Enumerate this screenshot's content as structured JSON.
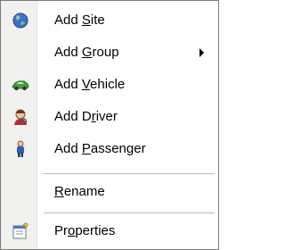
{
  "menu": {
    "items": [
      {
        "pre": "Add ",
        "ul": "S",
        "post": "ite",
        "icon": "globe-icon",
        "submenu": false
      },
      {
        "pre": "Add ",
        "ul": "G",
        "post": "roup",
        "icon": "",
        "submenu": true
      },
      {
        "pre": "Add ",
        "ul": "V",
        "post": "ehicle",
        "icon": "car-icon",
        "submenu": false
      },
      {
        "pre": "Add D",
        "ul": "r",
        "post": "iver",
        "icon": "driver-icon",
        "submenu": false
      },
      {
        "pre": "Add ",
        "ul": "P",
        "post": "assenger",
        "icon": "passenger-icon",
        "submenu": false
      },
      {
        "pre": "",
        "ul": "R",
        "post": "ename",
        "icon": "",
        "submenu": false
      },
      {
        "pre": "Pr",
        "ul": "o",
        "post": "perties",
        "icon": "properties-icon",
        "submenu": false
      }
    ]
  }
}
